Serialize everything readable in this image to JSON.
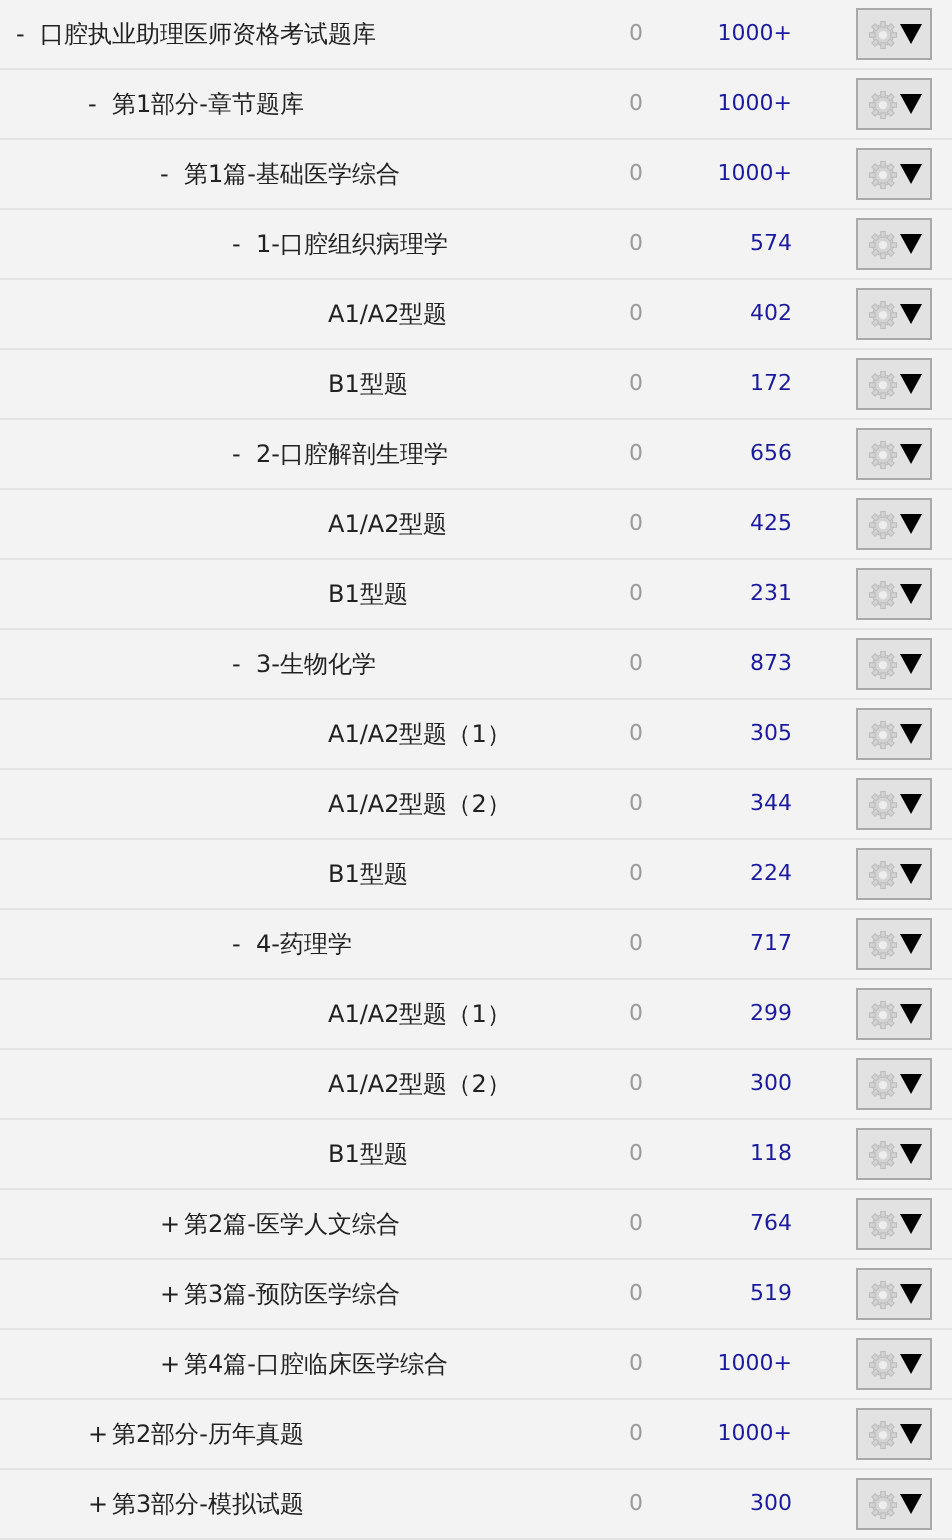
{
  "tree": [
    {
      "toggle": "-",
      "title": "口腔执业助理医师资格考试题库",
      "done": "0",
      "total": "1000+",
      "children": [
        {
          "toggle": "-",
          "title": "第1部分-章节题库",
          "done": "0",
          "total": "1000+",
          "children": [
            {
              "toggle": "-",
              "title": "第1篇-基础医学综合",
              "done": "0",
              "total": "1000+",
              "children": [
                {
                  "toggle": "-",
                  "title": "1-口腔组织病理学",
                  "done": "0",
                  "total": "574",
                  "children": [
                    {
                      "title": "A1/A2型题",
                      "done": "0",
                      "total": "402"
                    },
                    {
                      "title": "B1型题",
                      "done": "0",
                      "total": "172"
                    }
                  ]
                },
                {
                  "toggle": "-",
                  "title": "2-口腔解剖生理学",
                  "done": "0",
                  "total": "656",
                  "children": [
                    {
                      "title": "A1/A2型题",
                      "done": "0",
                      "total": "425"
                    },
                    {
                      "title": "B1型题",
                      "done": "0",
                      "total": "231"
                    }
                  ]
                },
                {
                  "toggle": "-",
                  "title": "3-生物化学",
                  "done": "0",
                  "total": "873",
                  "children": [
                    {
                      "title": "A1/A2型题（1）",
                      "done": "0",
                      "total": "305"
                    },
                    {
                      "title": "A1/A2型题（2）",
                      "done": "0",
                      "total": "344"
                    },
                    {
                      "title": "B1型题",
                      "done": "0",
                      "total": "224"
                    }
                  ]
                },
                {
                  "toggle": "-",
                  "title": "4-药理学",
                  "done": "0",
                  "total": "717",
                  "children": [
                    {
                      "title": "A1/A2型题（1）",
                      "done": "0",
                      "total": "299"
                    },
                    {
                      "title": "A1/A2型题（2）",
                      "done": "0",
                      "total": "300"
                    },
                    {
                      "title": "B1型题",
                      "done": "0",
                      "total": "118"
                    }
                  ]
                }
              ]
            },
            {
              "toggle": "+",
              "title": "第2篇-医学人文综合",
              "done": "0",
              "total": "764"
            },
            {
              "toggle": "+",
              "title": "第3篇-预防医学综合",
              "done": "0",
              "total": "519"
            },
            {
              "toggle": "+",
              "title": "第4篇-口腔临床医学综合",
              "done": "0",
              "total": "1000+"
            }
          ]
        },
        {
          "toggle": "+",
          "title": "第2部分-历年真题",
          "done": "0",
          "total": "1000+"
        },
        {
          "toggle": "+",
          "title": "第3部分-模拟试题",
          "done": "0",
          "total": "300"
        }
      ]
    }
  ]
}
